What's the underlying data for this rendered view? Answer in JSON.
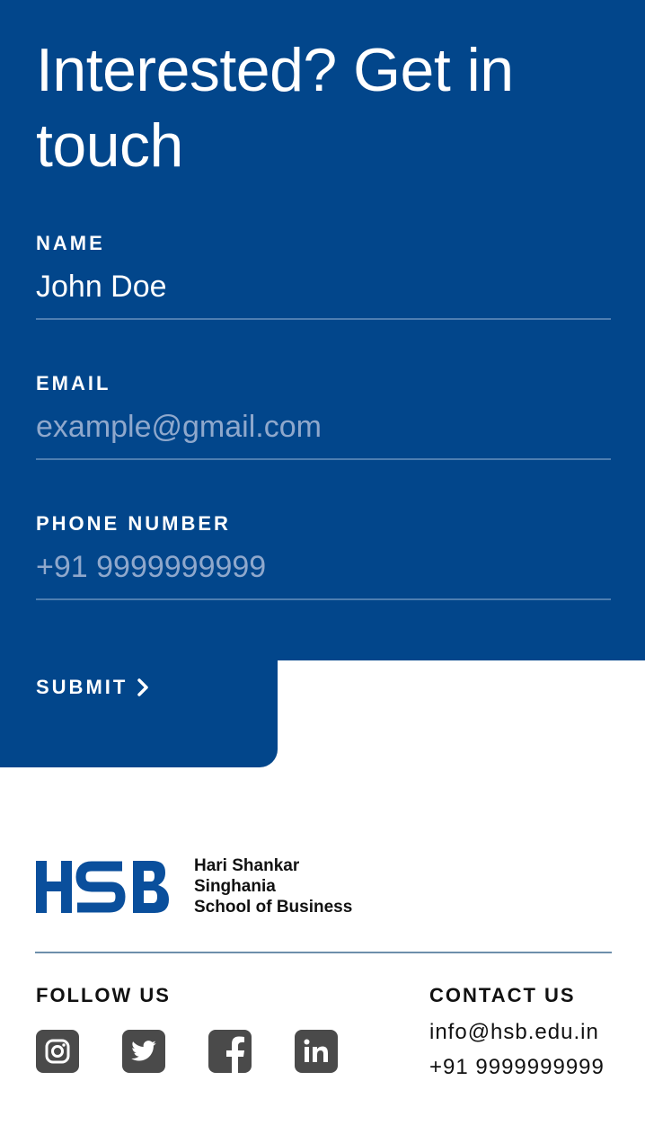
{
  "form": {
    "title": "Interested? Get in touch",
    "name": {
      "label": "NAME",
      "value": "John Doe",
      "placeholder": ""
    },
    "email": {
      "label": "EMAIL",
      "value": "",
      "placeholder": "example@gmail.com"
    },
    "phone": {
      "label": "PHONE NUMBER",
      "value": "",
      "placeholder": "+91 9999999999"
    },
    "submit_label": "SUBMIT",
    "submit_icon": "chevron-right-icon",
    "background_color": "#02468b"
  },
  "footer": {
    "logo": {
      "mark": "HSB",
      "lines": [
        "Hari Shankar",
        "Singhania",
        "School of Business"
      ],
      "color": "#0a4f9c"
    },
    "follow_heading": "FOLLOW US",
    "socials": [
      "instagram-icon",
      "twitter-icon",
      "facebook-icon",
      "linkedin-icon"
    ],
    "contact_heading": "CONTACT US",
    "contact_email": "info@hsb.edu.in",
    "contact_phone": "+91 9999999999"
  }
}
